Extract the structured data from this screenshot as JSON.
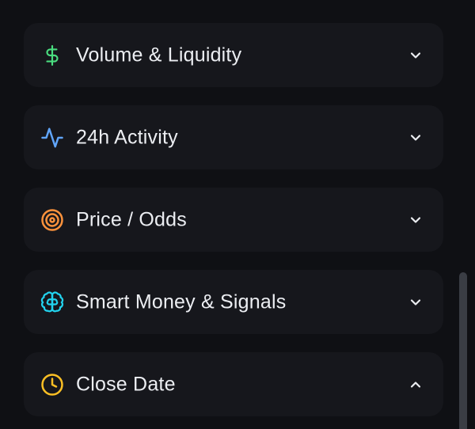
{
  "filters": {
    "sections": [
      {
        "label": "Volume & Liquidity",
        "icon": "dollar-icon",
        "icon_color": "#4ade80",
        "expanded": false
      },
      {
        "label": "24h Activity",
        "icon": "activity-icon",
        "icon_color": "#60a5fa",
        "expanded": false
      },
      {
        "label": "Price / Odds",
        "icon": "target-icon",
        "icon_color": "#fb923c",
        "expanded": false
      },
      {
        "label": "Smart Money & Signals",
        "icon": "brain-icon",
        "icon_color": "#22d3ee",
        "expanded": false
      },
      {
        "label": "Close Date",
        "icon": "clock-icon",
        "icon_color": "#fbbf24",
        "expanded": true
      }
    ]
  },
  "colors": {
    "background": "#0f1014",
    "card": "#16171c",
    "text": "#eceef2",
    "scrollbar": "#3a3d44"
  }
}
